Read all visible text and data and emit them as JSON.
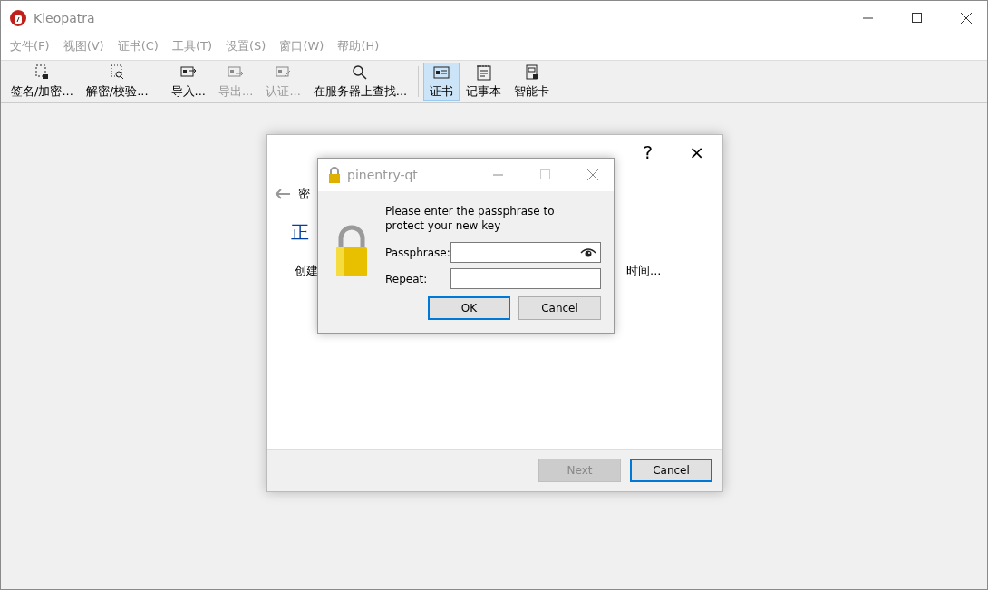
{
  "window": {
    "title": "Kleopatra"
  },
  "menu": [
    "文件(F)",
    "视图(V)",
    "证书(C)",
    "工具(T)",
    "设置(S)",
    "窗口(W)",
    "帮助(H)"
  ],
  "toolbar": {
    "groups": [
      [
        {
          "label": "签名/加密...",
          "disabled": false,
          "selected": false
        },
        {
          "label": "解密/校验...",
          "disabled": false,
          "selected": false
        }
      ],
      [
        {
          "label": "导入...",
          "disabled": false,
          "selected": false
        },
        {
          "label": "导出...",
          "disabled": true,
          "selected": false
        },
        {
          "label": "认证...",
          "disabled": true,
          "selected": false
        },
        {
          "label": "在服务器上查找...",
          "disabled": false,
          "selected": false
        }
      ],
      [
        {
          "label": "证书",
          "disabled": false,
          "selected": true
        },
        {
          "label": "记事本",
          "disabled": false,
          "selected": false
        },
        {
          "label": "智能卡",
          "disabled": false,
          "selected": false
        }
      ]
    ]
  },
  "wizard": {
    "help": "?",
    "close": "×",
    "back_title": "密",
    "heading": "正",
    "text_left": "创建",
    "text_right": "时间...",
    "buttons": [
      {
        "label": "Next",
        "disabled": true,
        "default": false
      },
      {
        "label": "Cancel",
        "disabled": false,
        "default": true
      }
    ]
  },
  "pinentry": {
    "title": "pinentry-qt",
    "message": "Please enter the passphrase to protect your new key",
    "fields": [
      {
        "label": "Passphrase:",
        "kind": "password"
      },
      {
        "label": "Repeat:",
        "kind": "plain"
      }
    ],
    "buttons": [
      {
        "label": "OK",
        "default": true
      },
      {
        "label": "Cancel",
        "default": false
      }
    ]
  }
}
